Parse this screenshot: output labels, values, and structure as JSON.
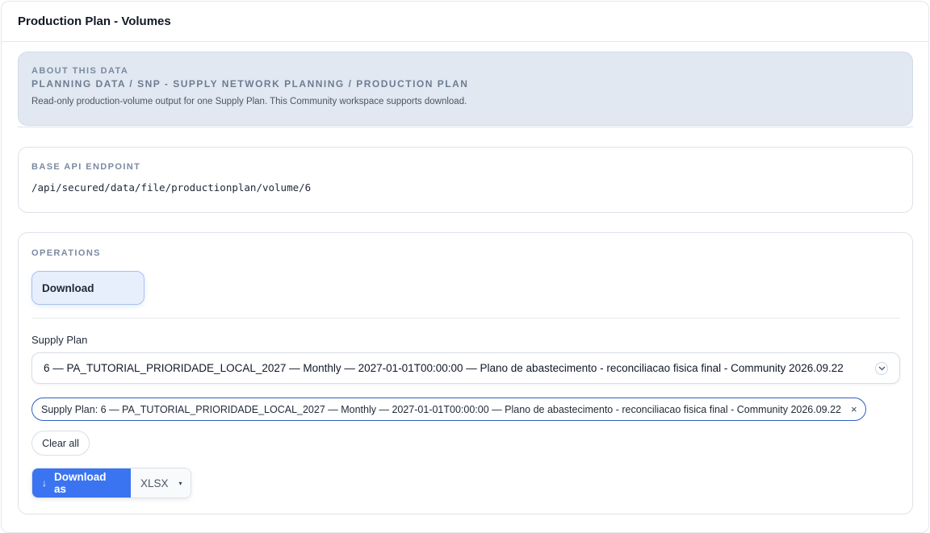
{
  "header": {
    "title": "Production Plan - Volumes"
  },
  "about": {
    "eyebrow": "ABOUT THIS DATA",
    "path": "PLANNING DATA / SNP - SUPPLY NETWORK PLANNING / PRODUCTION PLAN",
    "description": "Read-only production-volume output for one Supply Plan. This Community workspace supports download."
  },
  "endpoint": {
    "label": "BASE API ENDPOINT",
    "value": "/api/secured/data/file/productionplan/volume/6"
  },
  "operations": {
    "label": "OPERATIONS",
    "download_tab": "Download",
    "supply_plan_label": "Supply Plan",
    "supply_plan_value": "6 — PA_TUTORIAL_PRIORIDADE_LOCAL_2027 — Monthly — 2027-01-01T00:00:00 — Plano de abastecimento - reconciliacao fisica final - Community 2026.09.22",
    "chip": "Supply Plan: 6 — PA_TUTORIAL_PRIORIDADE_LOCAL_2027 — Monthly — 2027-01-01T00:00:00 — Plano de abastecimento - reconciliacao fisica final - Community 2026.09.22",
    "chip_remove": "×",
    "clear_all": "Clear all",
    "download_as": "Download as",
    "download_arrow": "↓",
    "format": "XLSX",
    "format_caret": "▾"
  },
  "icons": {
    "select": "chevron-down-icon",
    "download": "arrow-down-icon",
    "remove": "close-icon"
  },
  "colors": {
    "primary": "#3b74f0",
    "about_bg": "#e1e8f2",
    "chip_border": "#2f5fbf"
  }
}
